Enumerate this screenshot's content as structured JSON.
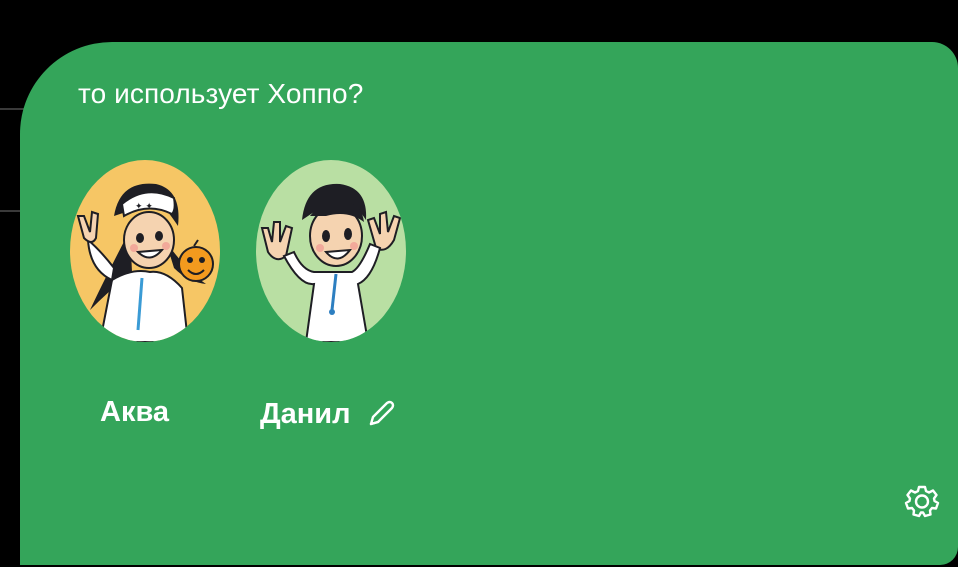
{
  "header": {
    "title": "то использует Хоппо?"
  },
  "profiles": [
    {
      "name": "Аква",
      "avatar": "girl-avatar"
    },
    {
      "name": "Данил",
      "avatar": "boy-avatar",
      "editable": true,
      "edit_icon": "pencil-icon"
    }
  ],
  "settings": {
    "icon": "gear-icon"
  },
  "colors": {
    "card_background": "#34a55a",
    "page_background": "#000000",
    "text": "#ffffff",
    "aqua_avatar_bg": "#f6c665",
    "danil_avatar_bg": "#b9dfa3"
  }
}
